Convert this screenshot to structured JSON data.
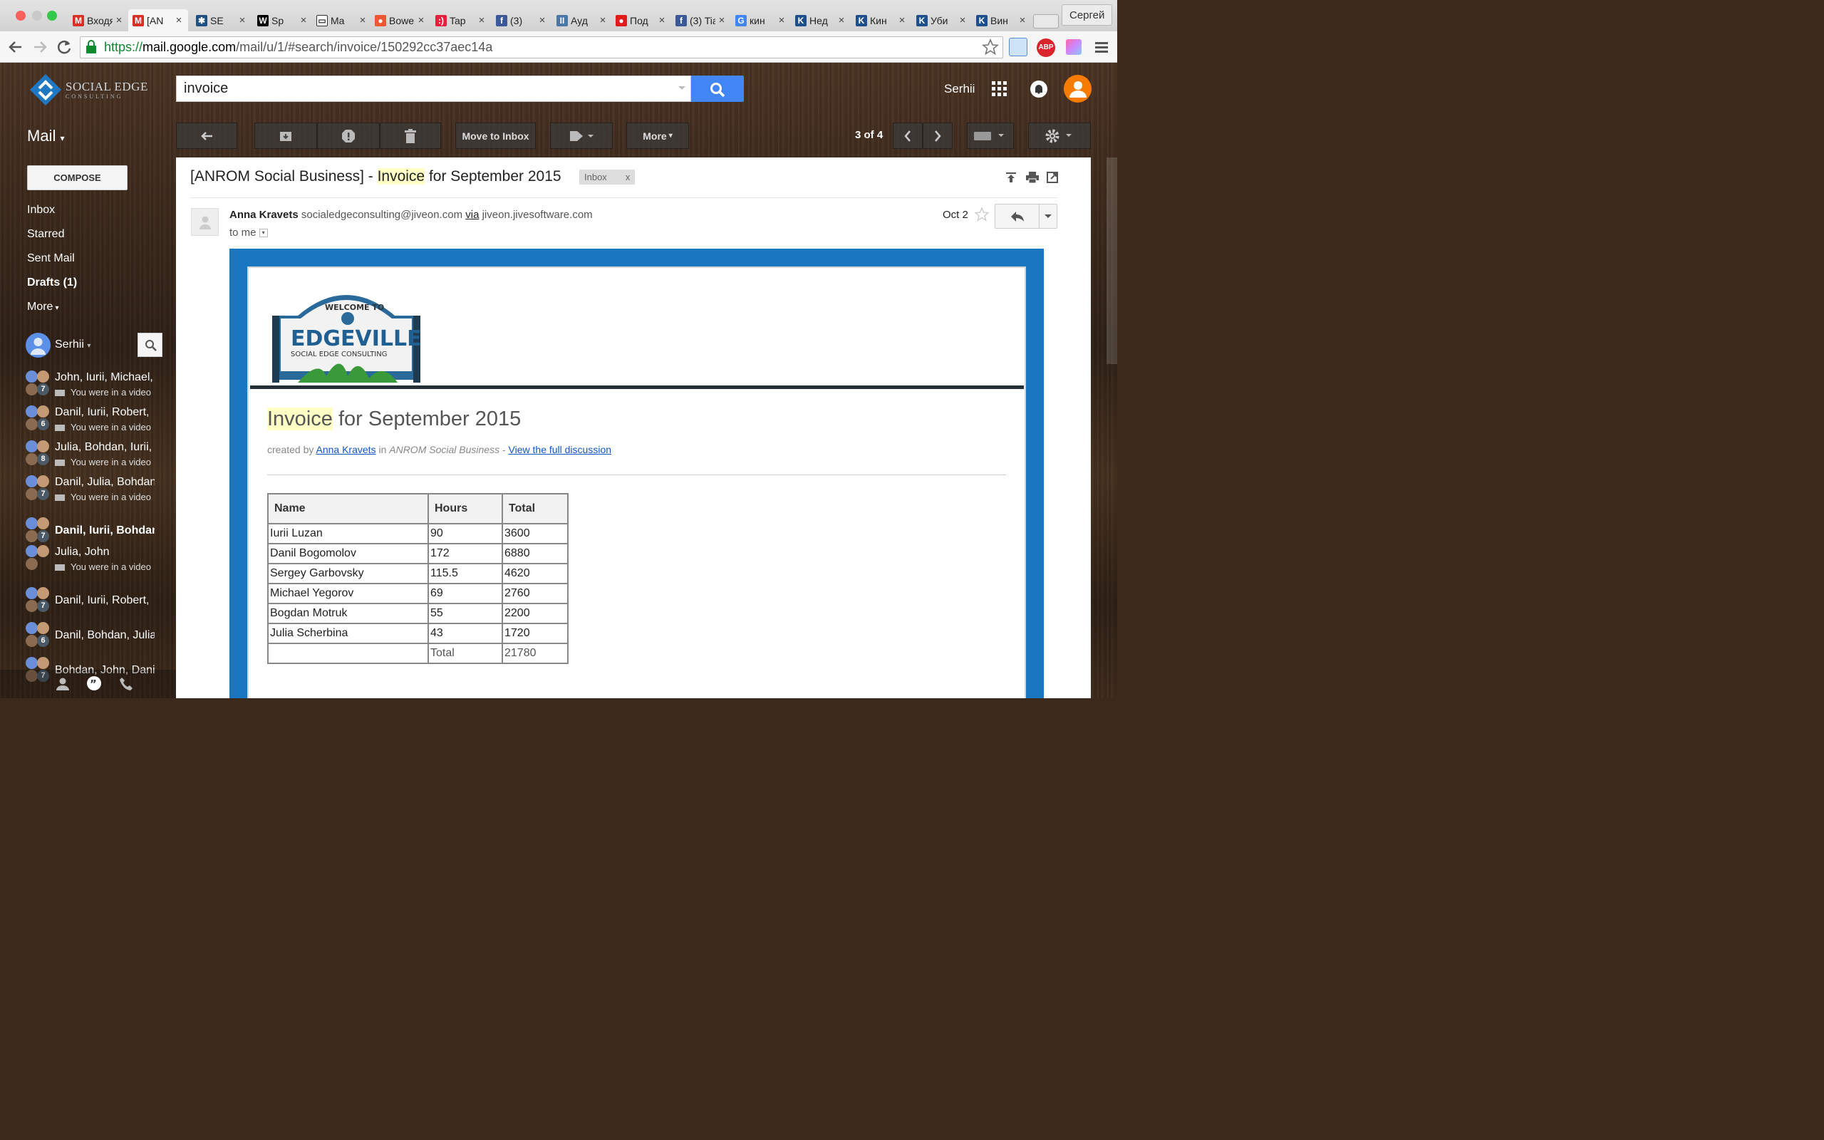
{
  "browser": {
    "tabs": [
      {
        "label": "Входящ",
        "icon": "gmail-icon"
      },
      {
        "label": "[AN",
        "icon": "gmail-icon"
      },
      {
        "label": "SE",
        "icon": "confluence-icon"
      },
      {
        "label": "Sp",
        "icon": "wikipedia-icon"
      },
      {
        "label": "Ma",
        "icon": "chat-icon"
      },
      {
        "label": "Bower",
        "icon": "bower-icon"
      },
      {
        "label": "Tap",
        "icon": "tap-icon"
      },
      {
        "label": "(3)",
        "icon": "facebook-icon"
      },
      {
        "label": "Ауд",
        "icon": "pause-icon"
      },
      {
        "label": "Под",
        "icon": "map-pin-icon"
      },
      {
        "label": "(3) Tia",
        "icon": "facebook-icon"
      },
      {
        "label": "кин",
        "icon": "google-icon"
      },
      {
        "label": "Нед",
        "icon": "k-icon"
      },
      {
        "label": "Кин",
        "icon": "k-icon"
      },
      {
        "label": "Уби",
        "icon": "k-icon"
      },
      {
        "label": "Вин",
        "icon": "k-icon"
      }
    ],
    "profile_name": "Сергей",
    "url_scheme": "https://",
    "url_host": "mail.google.com",
    "url_path": "/mail/u/1/#search/invoice/150292cc37aec14a",
    "extension_badge": "ABP"
  },
  "header": {
    "logo_text": "SOCIAL EDGE",
    "logo_sub": "CONSULTING",
    "search_value": "invoice",
    "user_name": "Serhii"
  },
  "toolbar": {
    "move_to_inbox": "Move to Inbox",
    "more": "More",
    "pager": "3 of 4"
  },
  "nav": {
    "mail_label": "Mail",
    "compose": "COMPOSE",
    "items": [
      "Inbox",
      "Starred",
      "Sent Mail",
      "Drafts (1)",
      "More"
    ],
    "hangouts_user": "Serhii"
  },
  "hangouts": [
    {
      "names": "John, Iurii, Michael,",
      "sub": "You were in a video",
      "count": "7"
    },
    {
      "names": "Danil, Iurii, Robert,",
      "sub": "You were in a video",
      "count": "6"
    },
    {
      "names": "Julia, Bohdan, Iurii,",
      "sub": "You were in a video",
      "count": "8"
    },
    {
      "names": "Danil, Julia, Bohdan",
      "sub": "You were in a video",
      "count": "7"
    },
    {
      "names": "Danil, Iurii, Bohdan",
      "sub": "",
      "count": "7"
    },
    {
      "names": "Julia, John",
      "sub": "You were in a video",
      "count": ""
    },
    {
      "names": "Danil, Iurii, Robert,",
      "sub": "",
      "count": "7"
    },
    {
      "names": "Danil, Bohdan, Julia",
      "sub": "",
      "count": "6"
    },
    {
      "names": "Bohdan, John, Danil",
      "sub": "",
      "count": "7"
    }
  ],
  "message": {
    "subject_prefix": "[ANROM Social Business] - ",
    "subject_highlight": "Invoice",
    "subject_suffix": " for September 2015",
    "label_chip": "Inbox",
    "label_chip_close": "x",
    "sender_name": "Anna Kravets",
    "sender_email": "socialedgeconsulting@jiveon.com",
    "via": "via",
    "via_domain": "jiveon.jivesoftware.com",
    "to": "to me",
    "date": "Oct 2"
  },
  "email_body": {
    "sign_top": "WELCOME TO",
    "sign_main": "EDGEVILLE",
    "sign_sub": "SOCIAL EDGE CONSULTING",
    "title_highlight": "Invoice",
    "title_rest": " for September 2015",
    "created_by": "created by ",
    "author": "Anna Kravets",
    "in_word": " in ",
    "place": "ANROM Social Business",
    "dash": " - ",
    "discussion_link": "View the full discussion",
    "table": {
      "headers": [
        "Name",
        "Hours",
        "Total"
      ],
      "rows": [
        [
          "Iurii Luzan",
          "90",
          "3600"
        ],
        [
          "Danil Bogomolov",
          "172",
          "6880"
        ],
        [
          "Sergey Garbovsky",
          "115.5",
          "4620"
        ],
        [
          "Michael Yegorov",
          "69",
          "2760"
        ],
        [
          "Bogdan Motruk",
          "55",
          "2200"
        ],
        [
          "Julia Scherbina",
          "43",
          "1720"
        ]
      ],
      "total_label": "Total",
      "total_value": "21780"
    }
  },
  "colors": {
    "accent_blue": "#4285f4",
    "frame_blue": "#1877c0",
    "highlight": "#ffffc6",
    "avatar_orange": "#f57c00"
  }
}
